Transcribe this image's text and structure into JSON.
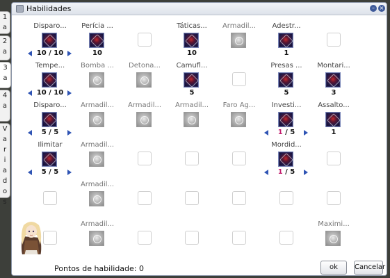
{
  "window": {
    "title": "Habilidades"
  },
  "tabs": [
    {
      "label": "1 a"
    },
    {
      "label": "2 a"
    },
    {
      "label": "3 a"
    },
    {
      "label": "4 a"
    },
    {
      "label": "Variados"
    }
  ],
  "skills": [
    {
      "name": "Disparo...",
      "state": "learned",
      "level": "10",
      "max": "10",
      "arrows": true
    },
    {
      "name": "Perícia ...",
      "state": "learned",
      "level": "10",
      "arrows": false
    },
    {
      "name": "",
      "state": "empty"
    },
    {
      "name": "Táticas...",
      "state": "learned",
      "level": "10",
      "arrows": false
    },
    {
      "name": "Armadil...",
      "state": "locked"
    },
    {
      "name": "Adestr...",
      "state": "learned",
      "level": "1",
      "arrows": false
    },
    {
      "name": "",
      "state": "empty"
    },
    {
      "name": "Tempe...",
      "state": "learned",
      "level": "10",
      "max": "10",
      "arrows": true
    },
    {
      "name": "Bomba ...",
      "state": "locked"
    },
    {
      "name": "Detona...",
      "state": "locked"
    },
    {
      "name": "Camufl...",
      "state": "learned",
      "level": "5",
      "arrows": false
    },
    {
      "name": "",
      "state": "empty"
    },
    {
      "name": "Presas ...",
      "state": "learned",
      "level": "5",
      "arrows": false
    },
    {
      "name": "Montari...",
      "state": "learned",
      "level": "3",
      "arrows": false
    },
    {
      "name": "Disparo...",
      "state": "learned",
      "level": "5",
      "max": "5",
      "arrows": true
    },
    {
      "name": "Armadil...",
      "state": "locked"
    },
    {
      "name": "Armadil...",
      "state": "locked"
    },
    {
      "name": "Armadil...",
      "state": "locked"
    },
    {
      "name": "Faro Ag...",
      "state": "locked"
    },
    {
      "name": "Investi...",
      "state": "learned",
      "level": "1",
      "max": "5",
      "arrows": true,
      "red": true
    },
    {
      "name": "Assalto...",
      "state": "learned",
      "level": "1",
      "arrows": false
    },
    {
      "name": "Ilimitar",
      "state": "learned",
      "level": "5",
      "max": "5",
      "arrows": true
    },
    {
      "name": "Armadil...",
      "state": "locked"
    },
    {
      "name": "",
      "state": "empty"
    },
    {
      "name": "",
      "state": "empty"
    },
    {
      "name": "",
      "state": "empty"
    },
    {
      "name": "Mordid...",
      "state": "learned",
      "level": "1",
      "max": "5",
      "arrows": true,
      "red": true
    },
    {
      "name": "",
      "state": "empty"
    },
    {
      "name": "",
      "state": "empty"
    },
    {
      "name": "Armadil...",
      "state": "locked"
    },
    {
      "name": "",
      "state": "empty"
    },
    {
      "name": "",
      "state": "empty"
    },
    {
      "name": "",
      "state": "empty"
    },
    {
      "name": "",
      "state": "empty"
    },
    {
      "name": "",
      "state": "empty"
    },
    {
      "name": "",
      "state": "empty"
    },
    {
      "name": "Armadil...",
      "state": "locked"
    },
    {
      "name": "",
      "state": "empty"
    },
    {
      "name": "",
      "state": "empty"
    },
    {
      "name": "",
      "state": "empty"
    },
    {
      "name": "",
      "state": "empty"
    },
    {
      "name": "Maximi...",
      "state": "locked"
    }
  ],
  "footer": {
    "points_label": "Pontos de habilidade: 0",
    "ok_label": "ok",
    "cancel_label": "Cancelar"
  },
  "icons": {
    "title": "window-icon",
    "minimize": "minimize-icon",
    "close": "close-icon",
    "skill": "skill-icon",
    "avatar": "character-avatar"
  },
  "colors": {
    "accent_arrow": "#2f54b4",
    "unspent_level": "#c21e6e",
    "learned_icon": "#201848"
  }
}
